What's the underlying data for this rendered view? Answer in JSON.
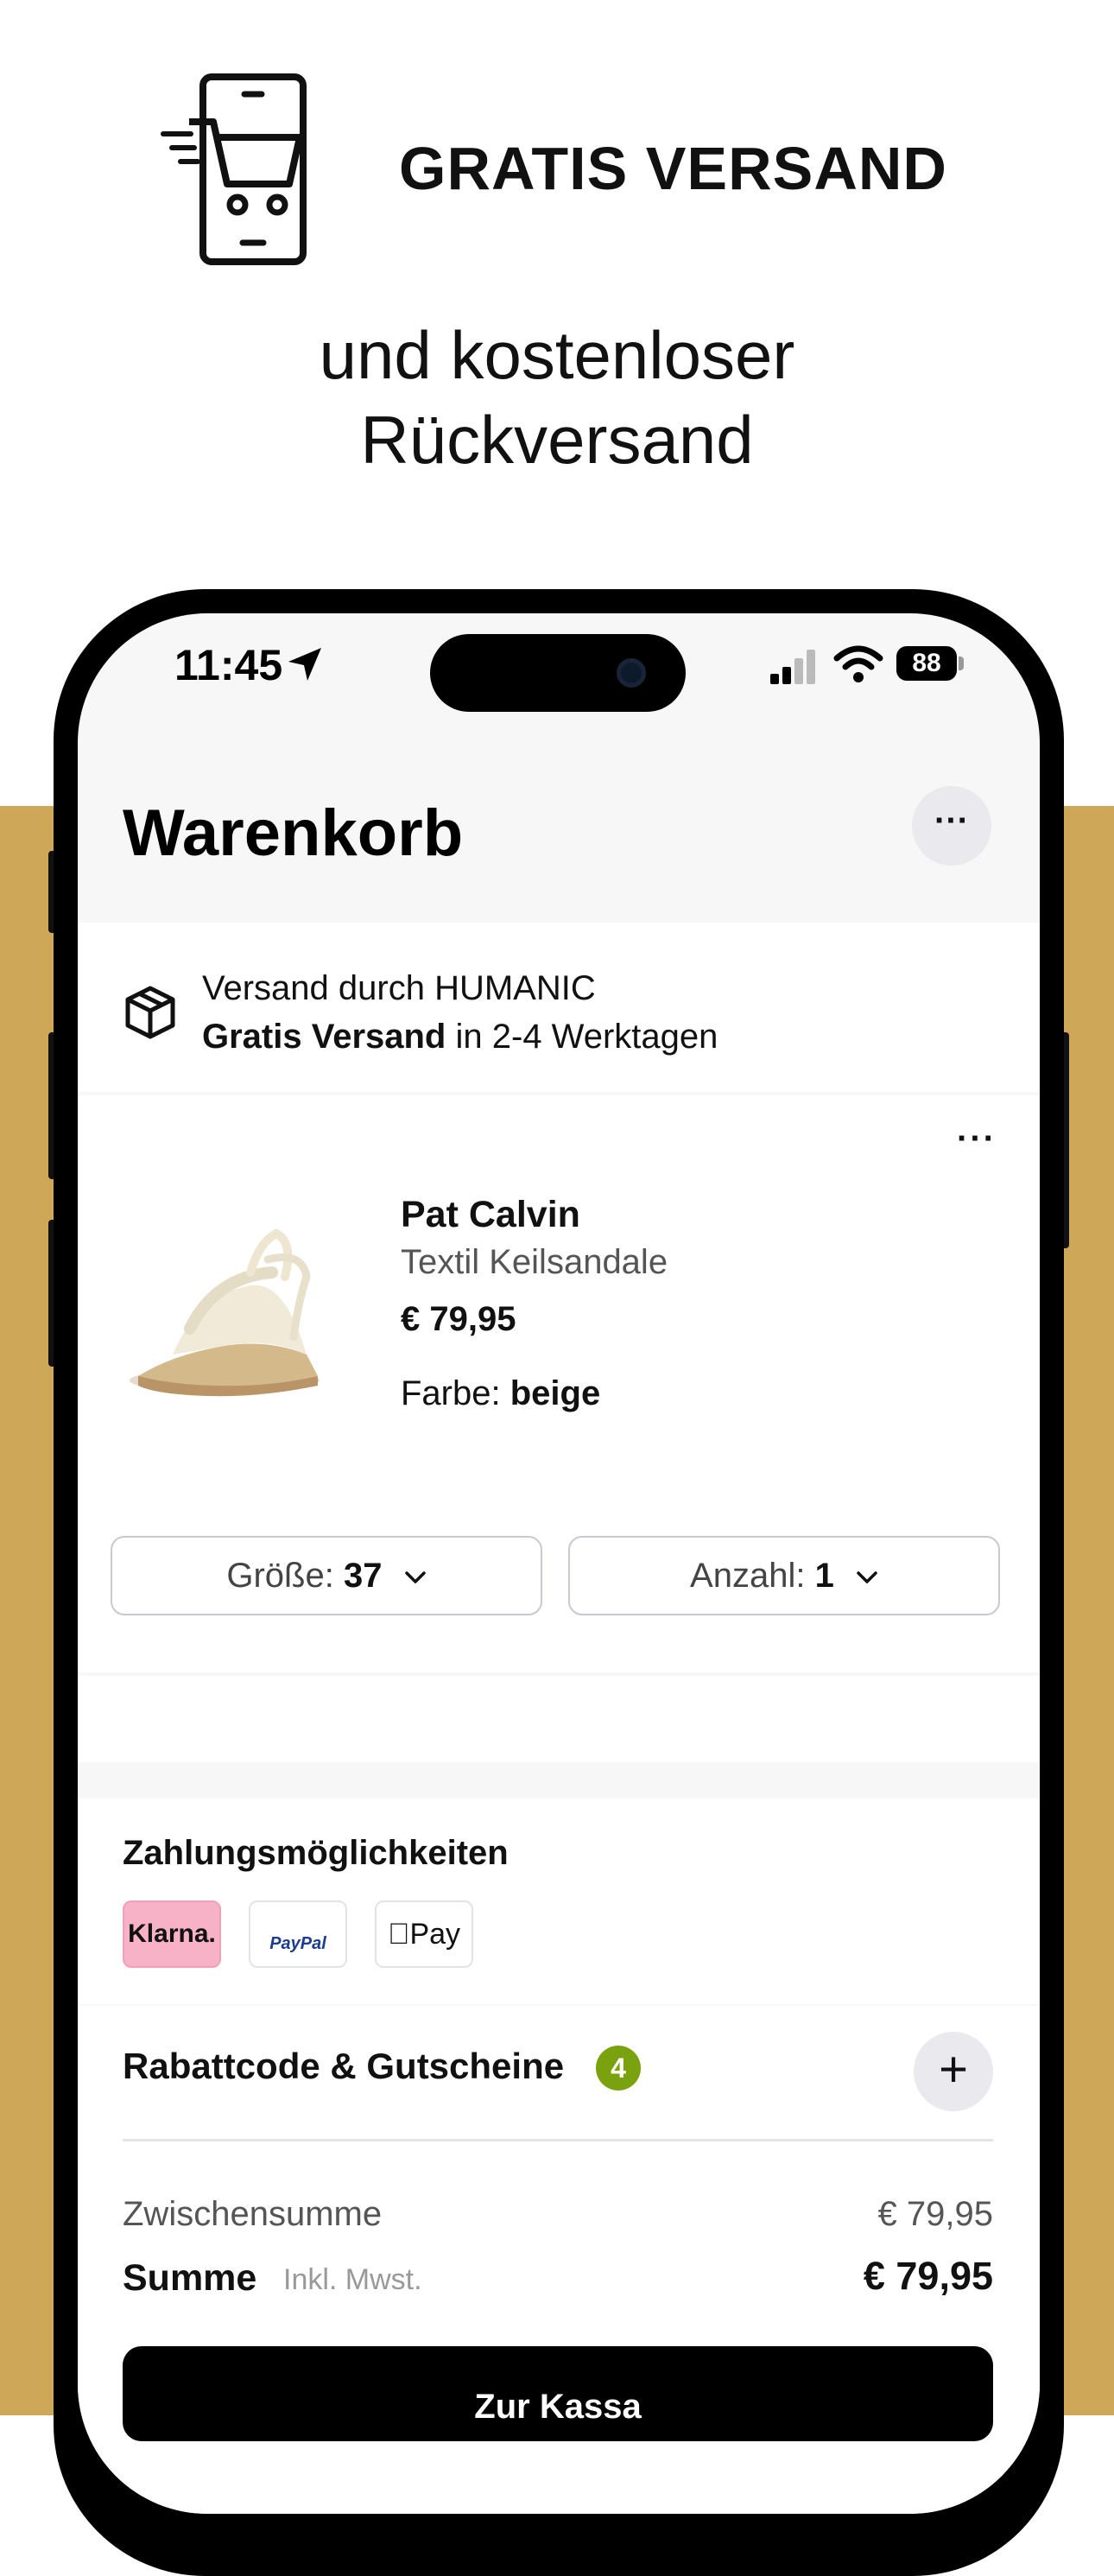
{
  "promo": {
    "title": "GRATIS VERSAND",
    "subtitle_line1": "und kostenloser",
    "subtitle_line2": "Rückversand",
    "icon": "mobile-cart-icon"
  },
  "status_bar": {
    "time": "11:45",
    "battery": "88"
  },
  "header": {
    "title": "Warenkorb",
    "more_icon": "more-dots-icon"
  },
  "shipping": {
    "line1": "Versand durch HUMANIC",
    "free_label": "Gratis Versand",
    "delivery_text": "in 2-4 Werktagen",
    "icon": "package-icon"
  },
  "cart_item": {
    "brand": "Pat Calvin",
    "description": "Textil Keilsandale",
    "price": "€ 79,95",
    "color_label": "Farbe:",
    "color_value": "beige",
    "size_label": "Größe:",
    "size_value": "37",
    "qty_label": "Anzahl:",
    "qty_value": "1"
  },
  "payment": {
    "title": "Zahlungsmöglichkeiten",
    "methods": [
      "Klarna.",
      "PayPal",
      "Pay"
    ]
  },
  "discount": {
    "title": "Rabattcode & Gutscheine",
    "count": "4"
  },
  "totals": {
    "subtotal_label": "Zwischensumme",
    "subtotal_value": "€ 79,95",
    "sum_label": "Summe",
    "sum_note": "Inkl. Mwst.",
    "sum_value": "€ 79,95"
  },
  "checkout": {
    "label": "Zur Kassa"
  },
  "colors": {
    "accent_bg": "#cfa759",
    "badge": "#7aa20f",
    "klarna_pink": "#f7b2c8"
  }
}
